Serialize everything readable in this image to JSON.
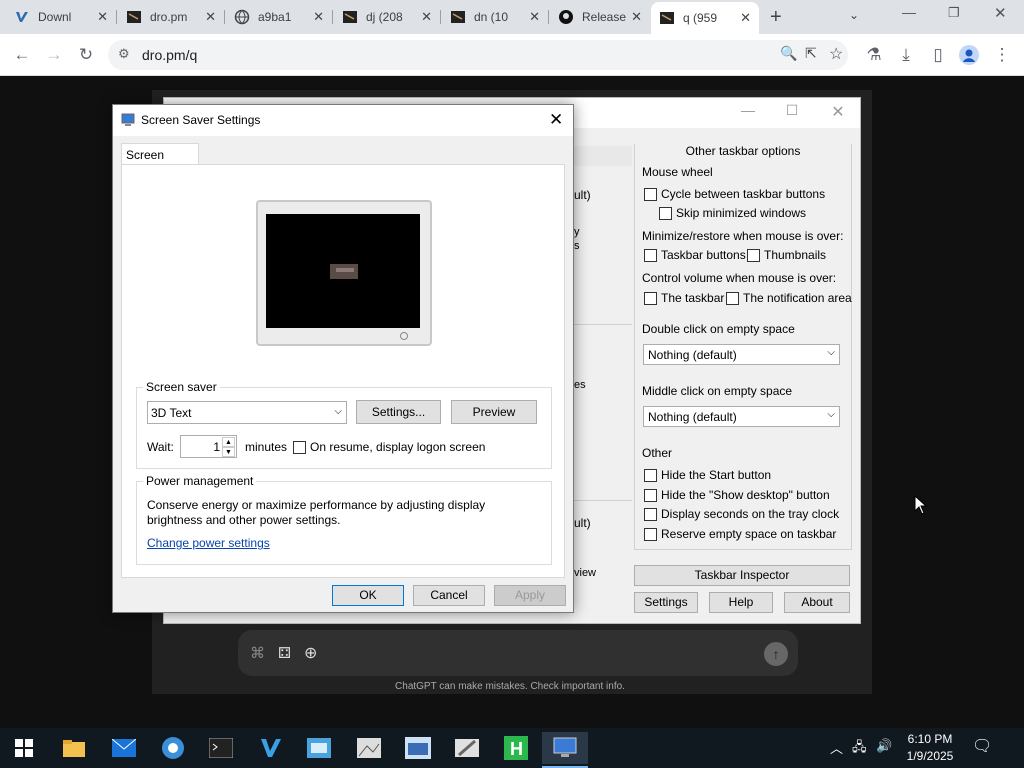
{
  "browser": {
    "tabs": [
      {
        "title": "Downl",
        "icon": "vs-icon"
      },
      {
        "title": "dro.pm",
        "icon": "terminal-favicon"
      },
      {
        "title": "a9ba1",
        "icon": "globe-icon"
      },
      {
        "title": "dj (208",
        "icon": "terminal-favicon"
      },
      {
        "title": "dn (10",
        "icon": "terminal-favicon"
      },
      {
        "title": "Release",
        "icon": "github-icon"
      },
      {
        "title": "q (959",
        "icon": "terminal-favicon",
        "active": true
      }
    ],
    "url": "dro.pm/q"
  },
  "page": {
    "disclaimer": "ChatGPT can make mistakes. Check important info."
  },
  "taskbar_window": {
    "group_title": "Other taskbar options",
    "partial_texts": [
      "ult)",
      "y",
      "s",
      "es",
      "ult)",
      "view"
    ],
    "mouse_wheel_label": "Mouse wheel",
    "cycle_label": "Cycle between taskbar buttons",
    "skip_min_label": "Skip minimized windows",
    "minimize_label": "Minimize/restore when mouse is over:",
    "taskbar_buttons_label": "Taskbar buttons",
    "thumbnails_label": "Thumbnails",
    "volume_label": "Control volume when mouse is over:",
    "the_taskbar_label": "The taskbar",
    "notification_label": "The notification area",
    "double_click_label": "Double click on empty space",
    "double_click_value": "Nothing (default)",
    "middle_click_label": "Middle click on empty space",
    "middle_click_value": "Nothing (default)",
    "other_label": "Other",
    "hide_start_label": "Hide the Start button",
    "hide_desktop_label": "Hide the \"Show desktop\" button",
    "seconds_label": "Display seconds on the tray clock",
    "reserve_label": "Reserve empty space on taskbar",
    "inspector_button": "Taskbar Inspector",
    "settings_button": "Settings",
    "help_button": "Help",
    "about_button": "About"
  },
  "screensaver_dialog": {
    "title": "Screen Saver Settings",
    "tab": "Screen Saver",
    "group_screensaver": "Screen saver",
    "selected_saver": "3D Text",
    "settings_button": "Settings...",
    "preview_button": "Preview",
    "wait_label": "Wait:",
    "wait_value": "1",
    "minutes_label": "minutes",
    "resume_label": "On resume, display logon screen",
    "group_power": "Power management",
    "power_text": "Conserve energy or maximize performance by adjusting display brightness and other power settings.",
    "power_link": "Change power settings",
    "ok_button": "OK",
    "cancel_button": "Cancel",
    "apply_button": "Apply"
  },
  "taskbar": {
    "time": "6:10 PM",
    "date": "1/9/2025"
  },
  "colors": {
    "taskbar_bg": "#101820",
    "accent": "#0078d7"
  }
}
